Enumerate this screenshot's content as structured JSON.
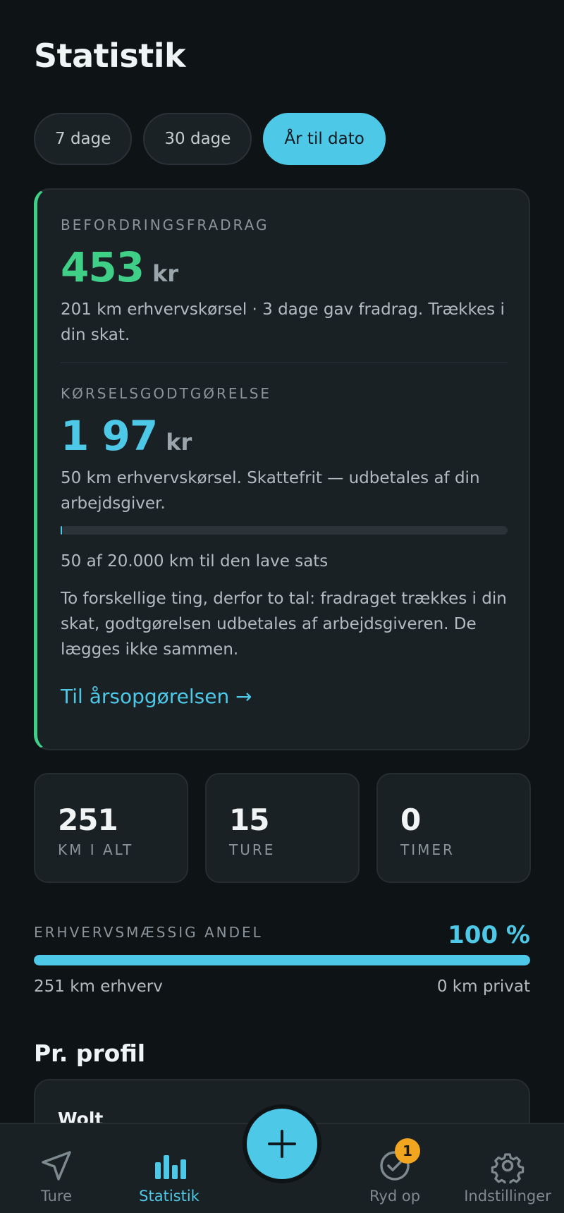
{
  "page": {
    "title": "Statistik"
  },
  "range_tabs": [
    {
      "label": "7 dage",
      "active": false
    },
    {
      "label": "30 dage",
      "active": false
    },
    {
      "label": "År til dato",
      "active": true
    }
  ],
  "deduction": {
    "eyebrow": "BEFORDRINGSFRADRAG",
    "amount": "453",
    "unit": "kr",
    "description": "201 km erhvervskørsel · 3 dage gav fradrag. Trækkes i din skat.",
    "color": "#3fcf87"
  },
  "allowance": {
    "eyebrow": "KØRSELSGODTGØRELSE",
    "amount": "1 97",
    "unit": "kr",
    "description": "50 km erhvervskørsel. Skattefrit — udbetales af din arbejdsgiver.",
    "limit_progress_fraction": 0.0025,
    "limit_text": "50 af 20.000 km til den lave sats",
    "explanation": "To forskellige ting, derfor to tal: fradraget trækkes i din skat, godtgørelsen udbetales af arbejdsgiveren. De lægges ikke sammen.",
    "link_label": "Til årsopgørelsen →",
    "color": "#4ec8e7"
  },
  "stats": [
    {
      "value": "251",
      "label": "KM I ALT"
    },
    {
      "value": "15",
      "label": "TURE"
    },
    {
      "value": "0",
      "label": "TIMER"
    }
  ],
  "business_share": {
    "label": "ERHVERVSMÆSSIG ANDEL",
    "percent_text": "100 %",
    "fraction": 1.0,
    "business_text": "251 km erhverv",
    "private_text": "0 km privat"
  },
  "profiles": {
    "section_title": "Pr. profil",
    "items": [
      {
        "name": "Wolt"
      }
    ]
  },
  "bottom_nav": {
    "items": [
      {
        "label": "Ture",
        "icon": "navigation-arrow-icon",
        "active": false
      },
      {
        "label": "Statistik",
        "icon": "bar-chart-icon",
        "active": true
      },
      {
        "label": "Ryd op",
        "icon": "check-circle-icon",
        "active": false,
        "badge": "1"
      },
      {
        "label": "Indstillinger",
        "icon": "gear-icon",
        "active": false
      }
    ],
    "fab_icon": "plus-icon"
  },
  "colors": {
    "accent": "#4ec8e7",
    "positive": "#3fcf87",
    "badge": "#f2a51f",
    "background": "#0e1316",
    "card": "#1a2125"
  }
}
